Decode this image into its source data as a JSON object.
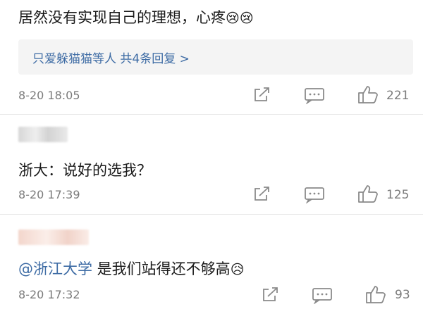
{
  "comments": [
    {
      "text": "居然没有实现自己的理想，心疼",
      "emoji": [
        "😢",
        "😢"
      ],
      "replies": "只爱躲猫猫等人 共4条回复 >",
      "time": "8-20 18:05",
      "likes": "221"
    },
    {
      "text": "浙大：说好的选我？",
      "time": "8-20 17:39",
      "likes": "125"
    },
    {
      "mention": "@浙江大学",
      "text": " 是我们站得还不够高",
      "emoji": [
        "😥"
      ],
      "time": "8-20 17:32",
      "likes": "93"
    }
  ],
  "icons": {
    "share": "share-icon",
    "comment": "comment-icon",
    "like": "thumbs-up-icon"
  },
  "colors": {
    "link": "#3d6ba4",
    "meta": "#7b7b7b",
    "reply_bg": "#f4f4f4"
  }
}
